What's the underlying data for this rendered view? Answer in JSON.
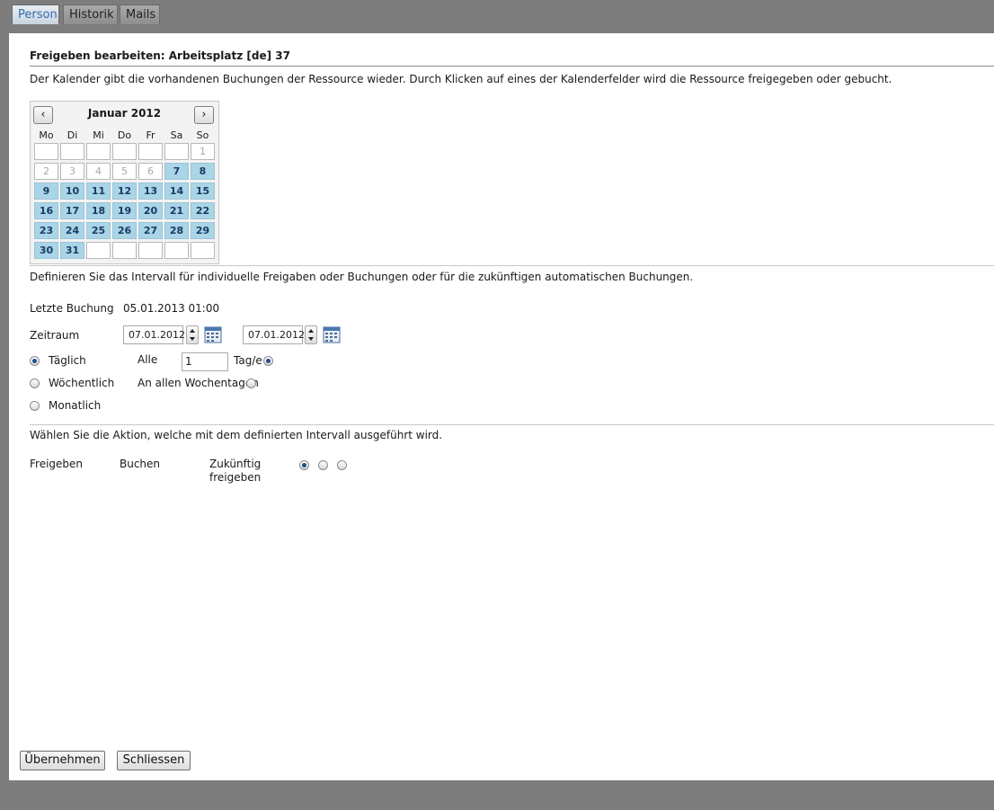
{
  "tabs": [
    {
      "label": "Person",
      "active": true
    },
    {
      "label": "Historik",
      "active": false
    },
    {
      "label": "Mails",
      "active": false
    }
  ],
  "form": {
    "title": "Freigeben bearbeiten: Arbeitsplatz [de] 37",
    "description": "Der Kalender gibt die vorhandenen Buchungen der Ressource wieder. Durch Klicken auf eines der Kalenderfelder wird die Ressource freigegeben oder gebucht.",
    "interval_description": "Definieren Sie das Intervall für individuelle Freigaben oder Buchungen oder für die zukünftigen automatischen Buchungen.",
    "action_description": "Wählen Sie die Aktion, welche mit dem definierten Intervall ausgeführt wird."
  },
  "calendar": {
    "month_label": "Januar 2012",
    "prev_icon": "chevron-left-icon",
    "next_icon": "chevron-right-icon",
    "weekdays": [
      "Mo",
      "Di",
      "Mi",
      "Do",
      "Fr",
      "Sa",
      "So"
    ],
    "weeks": [
      [
        {
          "d": "",
          "s": "empty"
        },
        {
          "d": "",
          "s": "empty"
        },
        {
          "d": "",
          "s": "empty"
        },
        {
          "d": "",
          "s": "empty"
        },
        {
          "d": "",
          "s": "empty"
        },
        {
          "d": "",
          "s": "empty"
        },
        {
          "d": "1",
          "s": "muted"
        }
      ],
      [
        {
          "d": "2",
          "s": "muted"
        },
        {
          "d": "3",
          "s": "muted"
        },
        {
          "d": "4",
          "s": "muted"
        },
        {
          "d": "5",
          "s": "muted"
        },
        {
          "d": "6",
          "s": "muted"
        },
        {
          "d": "7",
          "s": "booked"
        },
        {
          "d": "8",
          "s": "booked"
        }
      ],
      [
        {
          "d": "9",
          "s": "booked"
        },
        {
          "d": "10",
          "s": "booked"
        },
        {
          "d": "11",
          "s": "booked"
        },
        {
          "d": "12",
          "s": "booked"
        },
        {
          "d": "13",
          "s": "booked"
        },
        {
          "d": "14",
          "s": "booked"
        },
        {
          "d": "15",
          "s": "booked"
        }
      ],
      [
        {
          "d": "16",
          "s": "booked"
        },
        {
          "d": "17",
          "s": "booked"
        },
        {
          "d": "18",
          "s": "booked"
        },
        {
          "d": "19",
          "s": "booked"
        },
        {
          "d": "20",
          "s": "booked"
        },
        {
          "d": "21",
          "s": "booked"
        },
        {
          "d": "22",
          "s": "booked"
        }
      ],
      [
        {
          "d": "23",
          "s": "booked"
        },
        {
          "d": "24",
          "s": "booked"
        },
        {
          "d": "25",
          "s": "booked"
        },
        {
          "d": "26",
          "s": "booked"
        },
        {
          "d": "27",
          "s": "booked"
        },
        {
          "d": "28",
          "s": "booked"
        },
        {
          "d": "29",
          "s": "booked"
        }
      ],
      [
        {
          "d": "30",
          "s": "booked"
        },
        {
          "d": "31",
          "s": "booked"
        },
        {
          "d": "",
          "s": "empty"
        },
        {
          "d": "",
          "s": "empty"
        },
        {
          "d": "",
          "s": "empty"
        },
        {
          "d": "",
          "s": "empty"
        },
        {
          "d": "",
          "s": "empty"
        }
      ]
    ],
    "booked_color": "#a9d5e6"
  },
  "last_booking": {
    "label": "Letzte Buchung",
    "value": "05.01.2013 01:00"
  },
  "period": {
    "label": "Zeitraum",
    "from": "07.01.2012",
    "to": "07.01.2012"
  },
  "recurrence": {
    "options": [
      {
        "label": "Täglich",
        "checked": true
      },
      {
        "label": "Wöchentlich",
        "checked": false
      },
      {
        "label": "Monatlich",
        "checked": false
      }
    ],
    "every_label": "Alle",
    "every_value": "1",
    "unit_label": "Tag/e",
    "all_weekdays_label": "An allen Wochentagen"
  },
  "actions": {
    "release": "Freigeben",
    "book": "Buchen",
    "future_release_line1": "Zukünftig",
    "future_release_line2": "freigeben",
    "selected": "release"
  },
  "buttons": {
    "apply": "Übernehmen",
    "close": "Schliessen"
  },
  "colors": {
    "accent": "#2f6db0",
    "chrome": "#7d7d7d"
  }
}
